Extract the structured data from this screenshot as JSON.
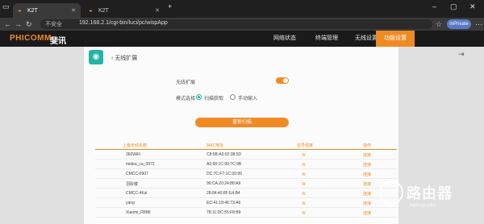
{
  "browser": {
    "tabs": [
      {
        "label": "K2T",
        "active": true
      },
      {
        "label": "K2T",
        "active": false
      }
    ],
    "new_tab": "+",
    "address": {
      "security": "不安全",
      "url": "192.168.2.1/cgi-bin/luci/pc/wispApp"
    },
    "profile": "InPrivate"
  },
  "router": {
    "logo": "PHICOMM",
    "logo_cn": "斐讯",
    "nav": [
      {
        "label": "网络状态",
        "active": false
      },
      {
        "label": "终端管理",
        "active": false
      },
      {
        "label": "无线设置",
        "active": false
      },
      {
        "label": "功能设置",
        "active": true
      }
    ]
  },
  "page": {
    "back_label": "无线扩展",
    "switch_label": "无线扩展",
    "switch_on": true,
    "mode_label": "模式选择",
    "mode_options": [
      {
        "label": "扫描获取",
        "selected": true
      },
      {
        "label": "手动输入",
        "selected": false
      }
    ],
    "scan_button": "重新扫描",
    "table": {
      "headers": [
        "上级无线名称",
        "MAC地址",
        "信号强度",
        "操作"
      ],
      "rows": [
        {
          "ssid": "360WiFi",
          "mac": "C8:5B:A0:02:38:5D",
          "action": "连接"
        },
        {
          "ssid": "midea_ca_0973",
          "mac": "A0:68:1C:90:7C:9B",
          "action": "连接"
        },
        {
          "ssid": "CMCC-0907",
          "mac": "DC:7C:F7:1C:20:99",
          "action": "连接"
        },
        {
          "ssid": "羽彤楼",
          "mac": "96:CA:20:24:88:A9",
          "action": "连接"
        },
        {
          "ssid": "CMCC-4Ksi",
          "mac": "28:84:40:8F:E4:B4",
          "action": "连接"
        },
        {
          "ssid": "yang",
          "mac": "EC:41:18:46:73:A6",
          "action": "连接"
        },
        {
          "ssid": "Xiaomi_FBB8",
          "mac": "78:11:DC:55:F8:B9",
          "action": "连接"
        }
      ]
    }
  },
  "watermark": {
    "text": "路由器",
    "sub": "luyouqi.com"
  },
  "colors": {
    "accent": "#f08b24",
    "teal": "#22b4a6"
  }
}
